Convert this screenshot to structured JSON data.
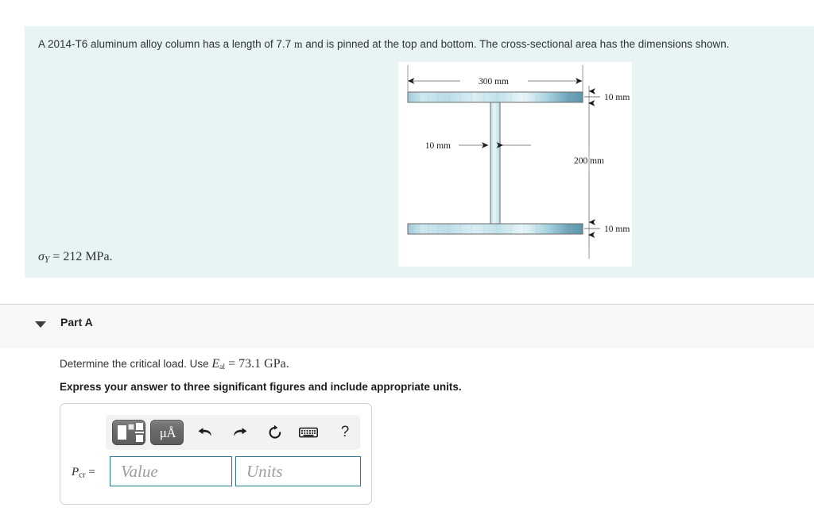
{
  "problem": {
    "statement_parts": {
      "p1": "A 2014-T6 aluminum alloy column has a length of 7.7 ",
      "unit_m": "m",
      "p2": " and is pinned at the top and bottom. The cross-sectional area has the dimensions shown."
    },
    "yield_stress": {
      "symbol": "σ",
      "subscript": "Y",
      "equals": "=",
      "value": "212",
      "unit": "MPa."
    }
  },
  "figure": {
    "name": "i-beam-cross-section",
    "labels": {
      "width": "300 mm",
      "top_flange": "10 mm",
      "bottom_flange": "10 mm",
      "web_thickness": "10 mm",
      "height": "200 mm"
    },
    "colors": {
      "flange_light": "#d8eef3",
      "flange_mid": "#a9d2de",
      "flange_dark": "#5d97ac",
      "outline": "#6b6b6b",
      "dim_line": "#8a8a8a",
      "panel_bg": "#ffffff"
    }
  },
  "part_a": {
    "caret": "collapse-caret",
    "title": "Part A",
    "question": {
      "lead": "Determine the critical load. Use ",
      "symbol_E": "E",
      "symbol_sub": "al",
      "equals": "=",
      "value": "73.1 GPa."
    },
    "instruction": "Express your answer to three significant figures and include appropriate units."
  },
  "answer_widget": {
    "toolbar": {
      "template_button": "math-template",
      "units_button": "μÅ",
      "undo": "undo",
      "redo": "redo",
      "reset": "reset",
      "keyboard": "keyboard",
      "help": "?"
    },
    "label": {
      "symbol": "P",
      "subscript": "cr",
      "equals": "="
    },
    "value_field": {
      "value": "",
      "placeholder": "Value"
    },
    "units_field": {
      "value": "",
      "placeholder": "Units"
    }
  },
  "theme": {
    "panel_bg": "#e7f4f3",
    "band_bg": "#f7f7f7",
    "input_border": "#2b7a94",
    "text": "#2f3337"
  }
}
